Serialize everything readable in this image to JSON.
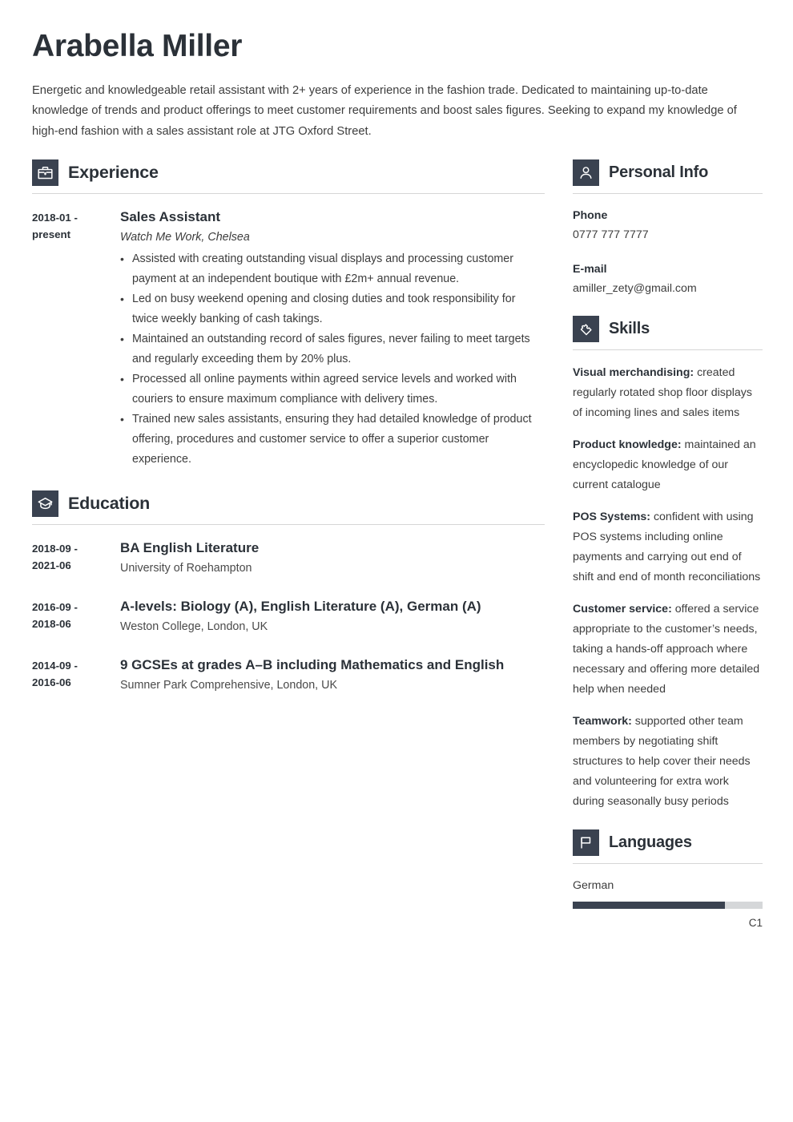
{
  "header": {
    "name": "Arabella Miller",
    "summary": "Energetic and knowledgeable retail assistant with 2+ years of experience in the fashion trade. Dedicated to maintaining up-to-date knowledge of trends and product offerings to meet customer requirements and boost sales figures. Seeking to expand my knowledge of high-end fashion with a sales assistant role at JTG Oxford Street."
  },
  "accent_color": "#3a4250",
  "experience": {
    "title": "Experience",
    "icon": "briefcase-icon",
    "entries": [
      {
        "dates_line1": "2018-01 -",
        "dates_line2": "present",
        "job_title": "Sales Assistant",
        "company": "Watch Me Work, Chelsea",
        "bullets": [
          "Assisted with creating outstanding visual displays and processing customer payment at an independent boutique with £2m+ annual revenue.",
          "Led on busy weekend opening and closing duties and took responsibility for twice weekly banking of cash takings.",
          "Maintained an outstanding record of sales figures, never failing to meet targets and regularly exceeding them by 20% plus.",
          "Processed all online payments within agreed service levels and worked with couriers to ensure maximum compliance with delivery times.",
          "Trained new sales assistants, ensuring they had detailed knowledge of product offering, procedures and customer service to offer a superior customer experience."
        ]
      }
    ]
  },
  "education": {
    "title": "Education",
    "icon": "graduation-cap-icon",
    "entries": [
      {
        "dates_line1": "2018-09 -",
        "dates_line2": "2021-06",
        "degree": "BA English Literature",
        "school": "University of Roehampton"
      },
      {
        "dates_line1": "2016-09 -",
        "dates_line2": "2018-06",
        "degree": "A-levels: Biology (A), English Literature (A), German (A)",
        "school": "Weston College, London, UK"
      },
      {
        "dates_line1": "2014-09 -",
        "dates_line2": "2016-06",
        "degree": "9 GCSEs at grades A–B including Mathematics and English",
        "school": "Sumner Park Comprehensive, London, UK"
      }
    ]
  },
  "personal_info": {
    "title": "Personal Info",
    "icon": "person-icon",
    "fields": [
      {
        "label": "Phone",
        "value": "0777 777 7777"
      },
      {
        "label": "E-mail",
        "value": "amiller_zety@gmail.com"
      }
    ]
  },
  "skills": {
    "title": "Skills",
    "icon": "puzzle-piece-icon",
    "items": [
      {
        "name": "Visual merchandising:",
        "desc": " created regularly rotated shop floor displays of incoming lines and sales items"
      },
      {
        "name": "Product knowledge:",
        "desc": " maintained an encyclopedic knowledge of our current catalogue"
      },
      {
        "name": "POS Systems:",
        "desc": " confident with using POS systems including online payments and carrying out end of shift and end of month reconciliations"
      },
      {
        "name": "Customer service:",
        "desc": " offered a service appropriate to the customer’s needs, taking a hands-off approach where necessary and offering more detailed help when needed"
      },
      {
        "name": "Teamwork:",
        "desc": " supported other team members by negotiating shift structures to help cover their needs and volunteering for extra work during seasonally busy periods"
      }
    ]
  },
  "languages": {
    "title": "Languages",
    "icon": "flag-icon",
    "items": [
      {
        "name": "German",
        "level": "C1",
        "percent": 80
      }
    ]
  }
}
